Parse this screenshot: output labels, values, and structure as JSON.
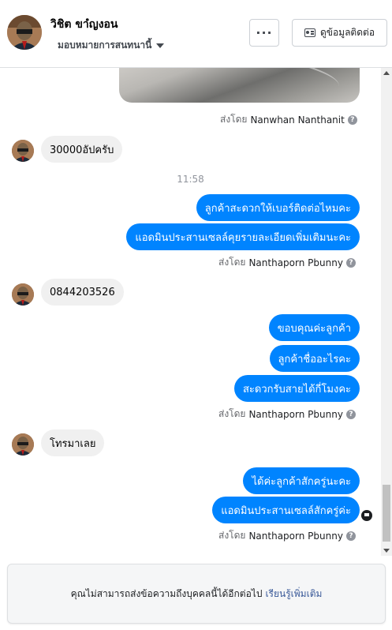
{
  "header": {
    "contact_name": "วิชิต ขาํญงอน",
    "assign_label": "มอบหมายการสนทนานี้",
    "more_label": "···",
    "contact_info_label": "ดูข้อมูลติดต่อ"
  },
  "messages": {
    "sent_by_prefix": "ส่งโดย",
    "sent_by_1": "Nanwhan Nanthanit",
    "incoming_1": "30000อัปครับ",
    "time_1": "11:58",
    "outgoing_1": "ลูกค้าสะดวกให้เบอร์ติดต่อไหมคะ",
    "outgoing_2": "แอดมินประสานเซลล์คุยรายละเอียดเพิ่มเติมนะคะ",
    "sent_by_2": "Nanthaporn Pbunny",
    "incoming_2": "0844203526",
    "outgoing_3": "ขอบคุณค่ะลูกค้า",
    "outgoing_4": "ลูกค้าชื่ออะไรคะ",
    "outgoing_5": "สะดวกรับสายได้กี่โมงคะ",
    "sent_by_3": "Nanthaporn Pbunny",
    "incoming_3": "โทรมาเลย",
    "outgoing_6": "ได้ค่ะลูกค้าสักครู่นะคะ",
    "outgoing_7": "แอดมินประสานเซลล์สักครู่ค่ะ",
    "sent_by_4": "Nanthaporn Pbunny"
  },
  "footer": {
    "notice_text": "คุณไม่สามารถส่งข้อความถึงบุคคลนี้ได้อีกต่อไป",
    "learn_more": "เรียนรู้เพิ่มเติม"
  },
  "colors": {
    "outgoing_bubble": "#0084ff",
    "incoming_bubble": "#f0f0f0"
  }
}
